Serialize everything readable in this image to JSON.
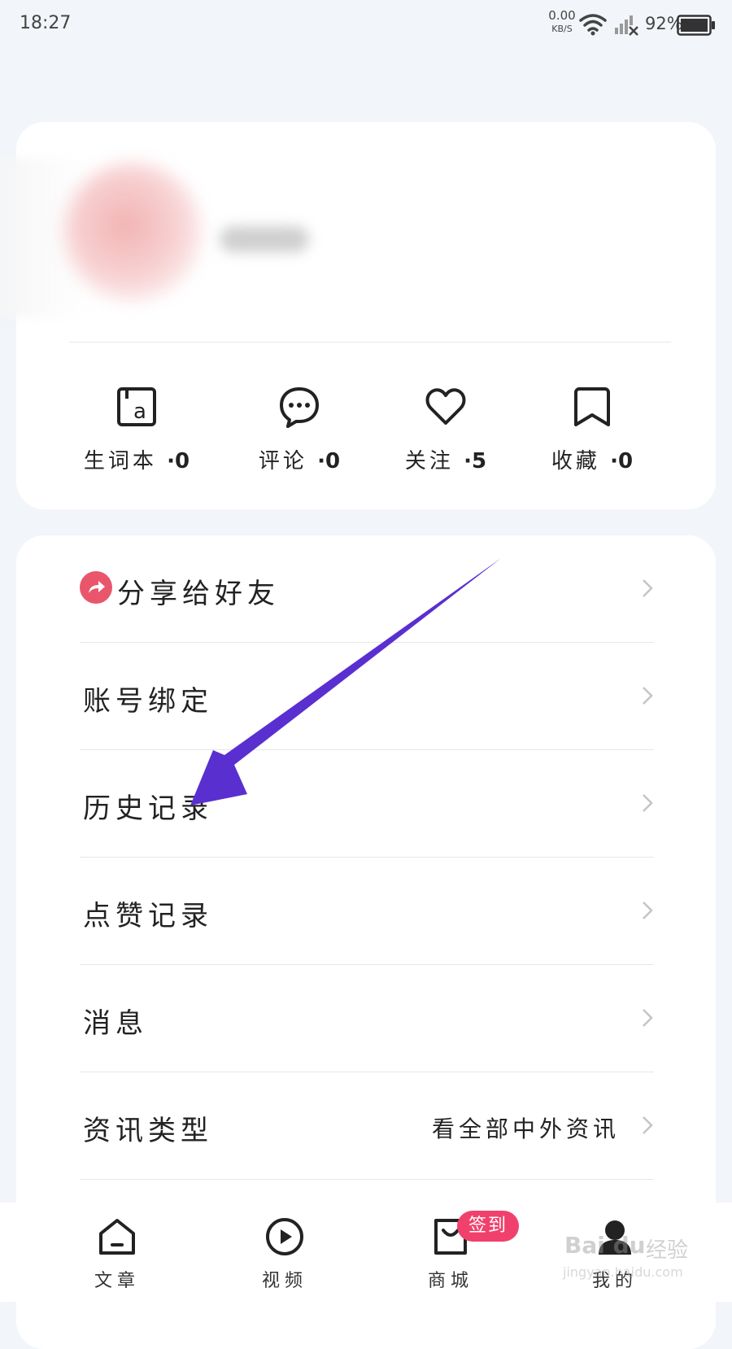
{
  "status_bar": {
    "time": "18:27",
    "net_speed_value": "0.00",
    "net_speed_unit": "KB/S",
    "battery": "92%"
  },
  "profile": {
    "stats": [
      {
        "label": "生词本",
        "count": "·0",
        "icon": "vocabulary-book-icon"
      },
      {
        "label": "评论",
        "count": "·0",
        "icon": "comment-bubble-icon"
      },
      {
        "label": "关注",
        "count": "·5",
        "icon": "heart-icon"
      },
      {
        "label": "收藏",
        "count": "·0",
        "icon": "bookmark-icon"
      }
    ]
  },
  "menu": {
    "items": [
      {
        "label": "分享给好友",
        "icon": "share-icon"
      },
      {
        "label": "账号绑定"
      },
      {
        "label": "历史记录"
      },
      {
        "label": "点赞记录"
      },
      {
        "label": "消息"
      },
      {
        "label": "资讯类型",
        "value": "看全部中外资讯"
      }
    ]
  },
  "bottom_nav": {
    "items": [
      {
        "label": "文章",
        "icon": "home-icon"
      },
      {
        "label": "视频",
        "icon": "play-circle-icon"
      },
      {
        "label": "商城",
        "icon": "shopping-bag-icon",
        "badge": "签到"
      },
      {
        "label": "我的",
        "icon": "profile-icon"
      }
    ]
  },
  "watermark": {
    "brand": "Bai du",
    "brand_cn": "经验",
    "url": "jingyan.baidu.com"
  },
  "colors": {
    "accent_share": "#e9566b",
    "badge": "#f0416c",
    "annotation_arrow": "#5a2fd0"
  }
}
